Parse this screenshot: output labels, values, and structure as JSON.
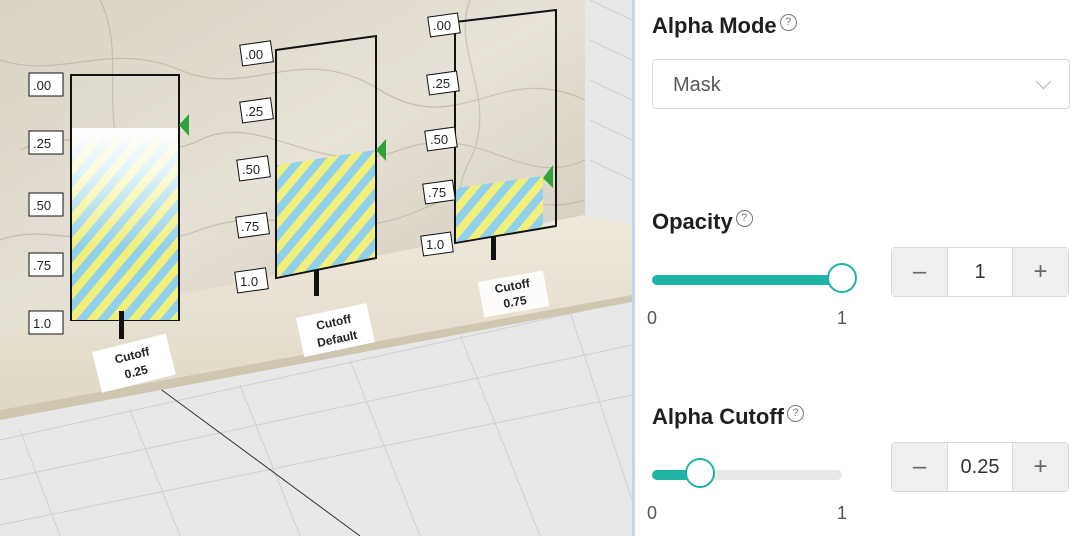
{
  "viewport": {
    "panels": [
      {
        "ticks": [
          ".00",
          ".25",
          ".50",
          ".75",
          "1.0"
        ],
        "plaque_line1": "Cutoff",
        "plaque_line2": "0.25"
      },
      {
        "ticks": [
          ".00",
          ".25",
          ".50",
          ".75",
          "1.0"
        ],
        "plaque_line1": "Cutoff",
        "plaque_line2": "Default"
      },
      {
        "ticks": [
          ".00",
          ".25",
          ".50",
          ".75",
          "1.0"
        ],
        "plaque_line1": "Cutoff",
        "plaque_line2": "0.75"
      }
    ],
    "colors": {
      "stripe_yellow": "#f2f07a",
      "stripe_blue": "#8fd0ec",
      "marker_green": "#2fa33a"
    }
  },
  "properties": {
    "alpha_mode": {
      "title": "Alpha Mode",
      "help_icon": "question-circle-icon",
      "selected": "Mask"
    },
    "opacity": {
      "title": "Opacity",
      "help_icon": "question-circle-icon",
      "value": "1",
      "slider_fraction": 1.0,
      "min_label": "0",
      "max_label": "1"
    },
    "alpha_cutoff": {
      "title": "Alpha Cutoff",
      "help_icon": "question-circle-icon",
      "value": "0.25",
      "slider_fraction": 0.25,
      "min_label": "0",
      "max_label": "1"
    },
    "colors": {
      "accent": "#1fb3a6"
    }
  }
}
